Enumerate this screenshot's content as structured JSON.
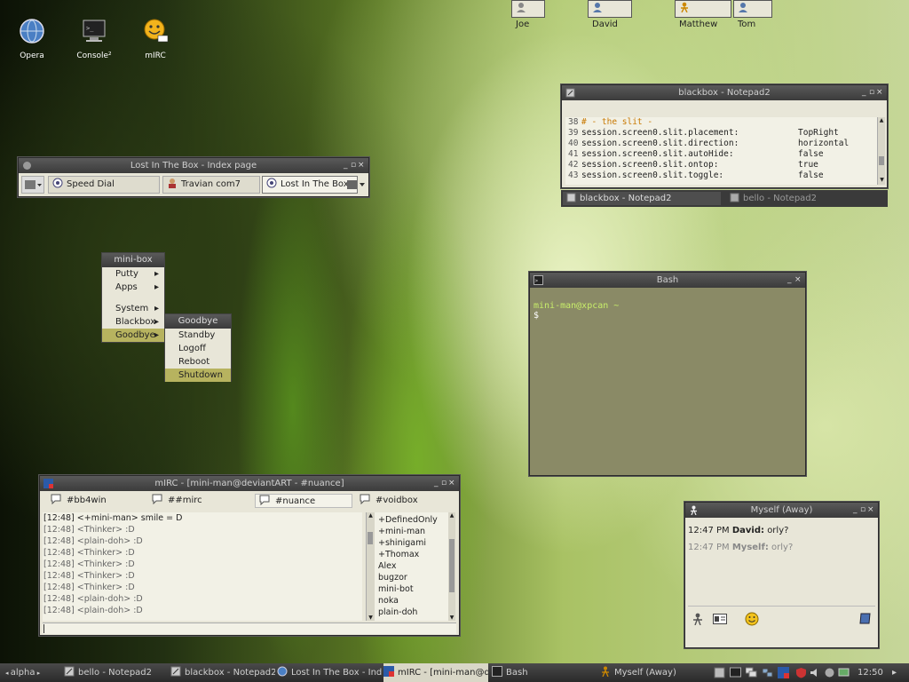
{
  "desktop_icons": [
    {
      "label": "Opera",
      "icon": "opera-icon"
    },
    {
      "label": "Console²",
      "icon": "console-icon"
    },
    {
      "label": "mIRC",
      "icon": "mirc-smiley-icon"
    }
  ],
  "pager": {
    "items": [
      "Joe",
      "David",
      "Matthew",
      "Tom"
    ]
  },
  "browser": {
    "title": "Lost In The Box - Index page",
    "tabs": [
      "Speed Dial",
      "Travian com7",
      "Lost In The Box - ..."
    ]
  },
  "notepad": {
    "title": "blackbox - Notepad2",
    "lines": [
      {
        "num": "38",
        "text": "# - the slit -",
        "value": ""
      },
      {
        "num": "39",
        "text": "session.screen0.slit.placement:",
        "value": "TopRight"
      },
      {
        "num": "40",
        "text": "session.screen0.slit.direction:",
        "value": "horizontal"
      },
      {
        "num": "41",
        "text": "session.screen0.slit.autoHide:",
        "value": "false"
      },
      {
        "num": "42",
        "text": "session.screen0.slit.ontop:",
        "value": "true"
      },
      {
        "num": "43",
        "text": "session.screen0.slit.toggle:",
        "value": "false"
      }
    ],
    "group_tabs": [
      "blackbox - Notepad2",
      "bello - Notepad2"
    ]
  },
  "menu": {
    "title": "mini-box",
    "items": [
      "Putty",
      "Apps",
      "System",
      "Blackbox",
      "Goodbye"
    ],
    "submenu": {
      "title": "Goodbye",
      "items": [
        "Standby",
        "Logoff",
        "Reboot",
        "Shutdown"
      ]
    }
  },
  "bash": {
    "title": "Bash",
    "prompt": "mini-man@xpcan ~",
    "cursor": "$"
  },
  "mirc": {
    "title": "mIRC - [mini-man@deviantART - #nuance]",
    "channels": [
      "#bb4win",
      "##mirc",
      "#nuance",
      "#voidbox"
    ],
    "messages": [
      "[12:48] <+mini-man> smile = D",
      "[12:48] <Thinker> :D",
      "[12:48] <plain-doh> :D",
      "[12:48] <Thinker> :D",
      "[12:48] <Thinker> :D",
      "[12:48] <Thinker> :D",
      "[12:48] <Thinker> :D",
      "[12:48] <plain-doh> :D",
      "[12:48] <plain-doh> :D"
    ],
    "nicks": [
      "+DefinedOnly",
      "+mini-man",
      "+shinigami",
      "+Thomax",
      "Alex",
      "bugzor",
      "mini-bot",
      "noka",
      "plain-doh"
    ]
  },
  "chat": {
    "title": "Myself (Away)",
    "messages": [
      {
        "time": "12:47 PM",
        "who": "David:",
        "text": "orly?"
      },
      {
        "time": "12:47 PM",
        "who": "Myself:",
        "text": "orly?"
      }
    ]
  },
  "taskbar": {
    "workspace": "alpha",
    "items": [
      "bello - Notepad2",
      "blackbox - Notepad2",
      "Lost In The Box - Ind...",
      "mIRC - [mini-man@d...",
      "Bash",
      "Myself (Away)"
    ],
    "clock": "12:50"
  },
  "colors": {
    "accent": "#b7b35f",
    "terminal_bg": "#8a8a66",
    "terminal_text": "#c8ee6a",
    "notepad_comment": "#c87800"
  }
}
